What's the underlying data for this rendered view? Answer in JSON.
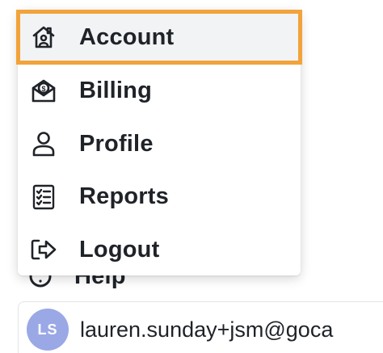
{
  "menu": {
    "items": [
      {
        "label": "Account",
        "icon": "home-icon",
        "active": true
      },
      {
        "label": "Billing",
        "icon": "billing-icon",
        "active": false
      },
      {
        "label": "Profile",
        "icon": "user-icon",
        "active": false
      },
      {
        "label": "Reports",
        "icon": "checklist-icon",
        "active": false
      },
      {
        "label": "Logout",
        "icon": "logout-icon",
        "active": false
      }
    ],
    "highlight_color": "#f2a33a"
  },
  "help": {
    "label": "Help",
    "icon": "help-icon"
  },
  "user": {
    "initials": "LS",
    "email": "lauren.sunday+jsm@goca",
    "avatar_color": "#9aa8e6"
  }
}
